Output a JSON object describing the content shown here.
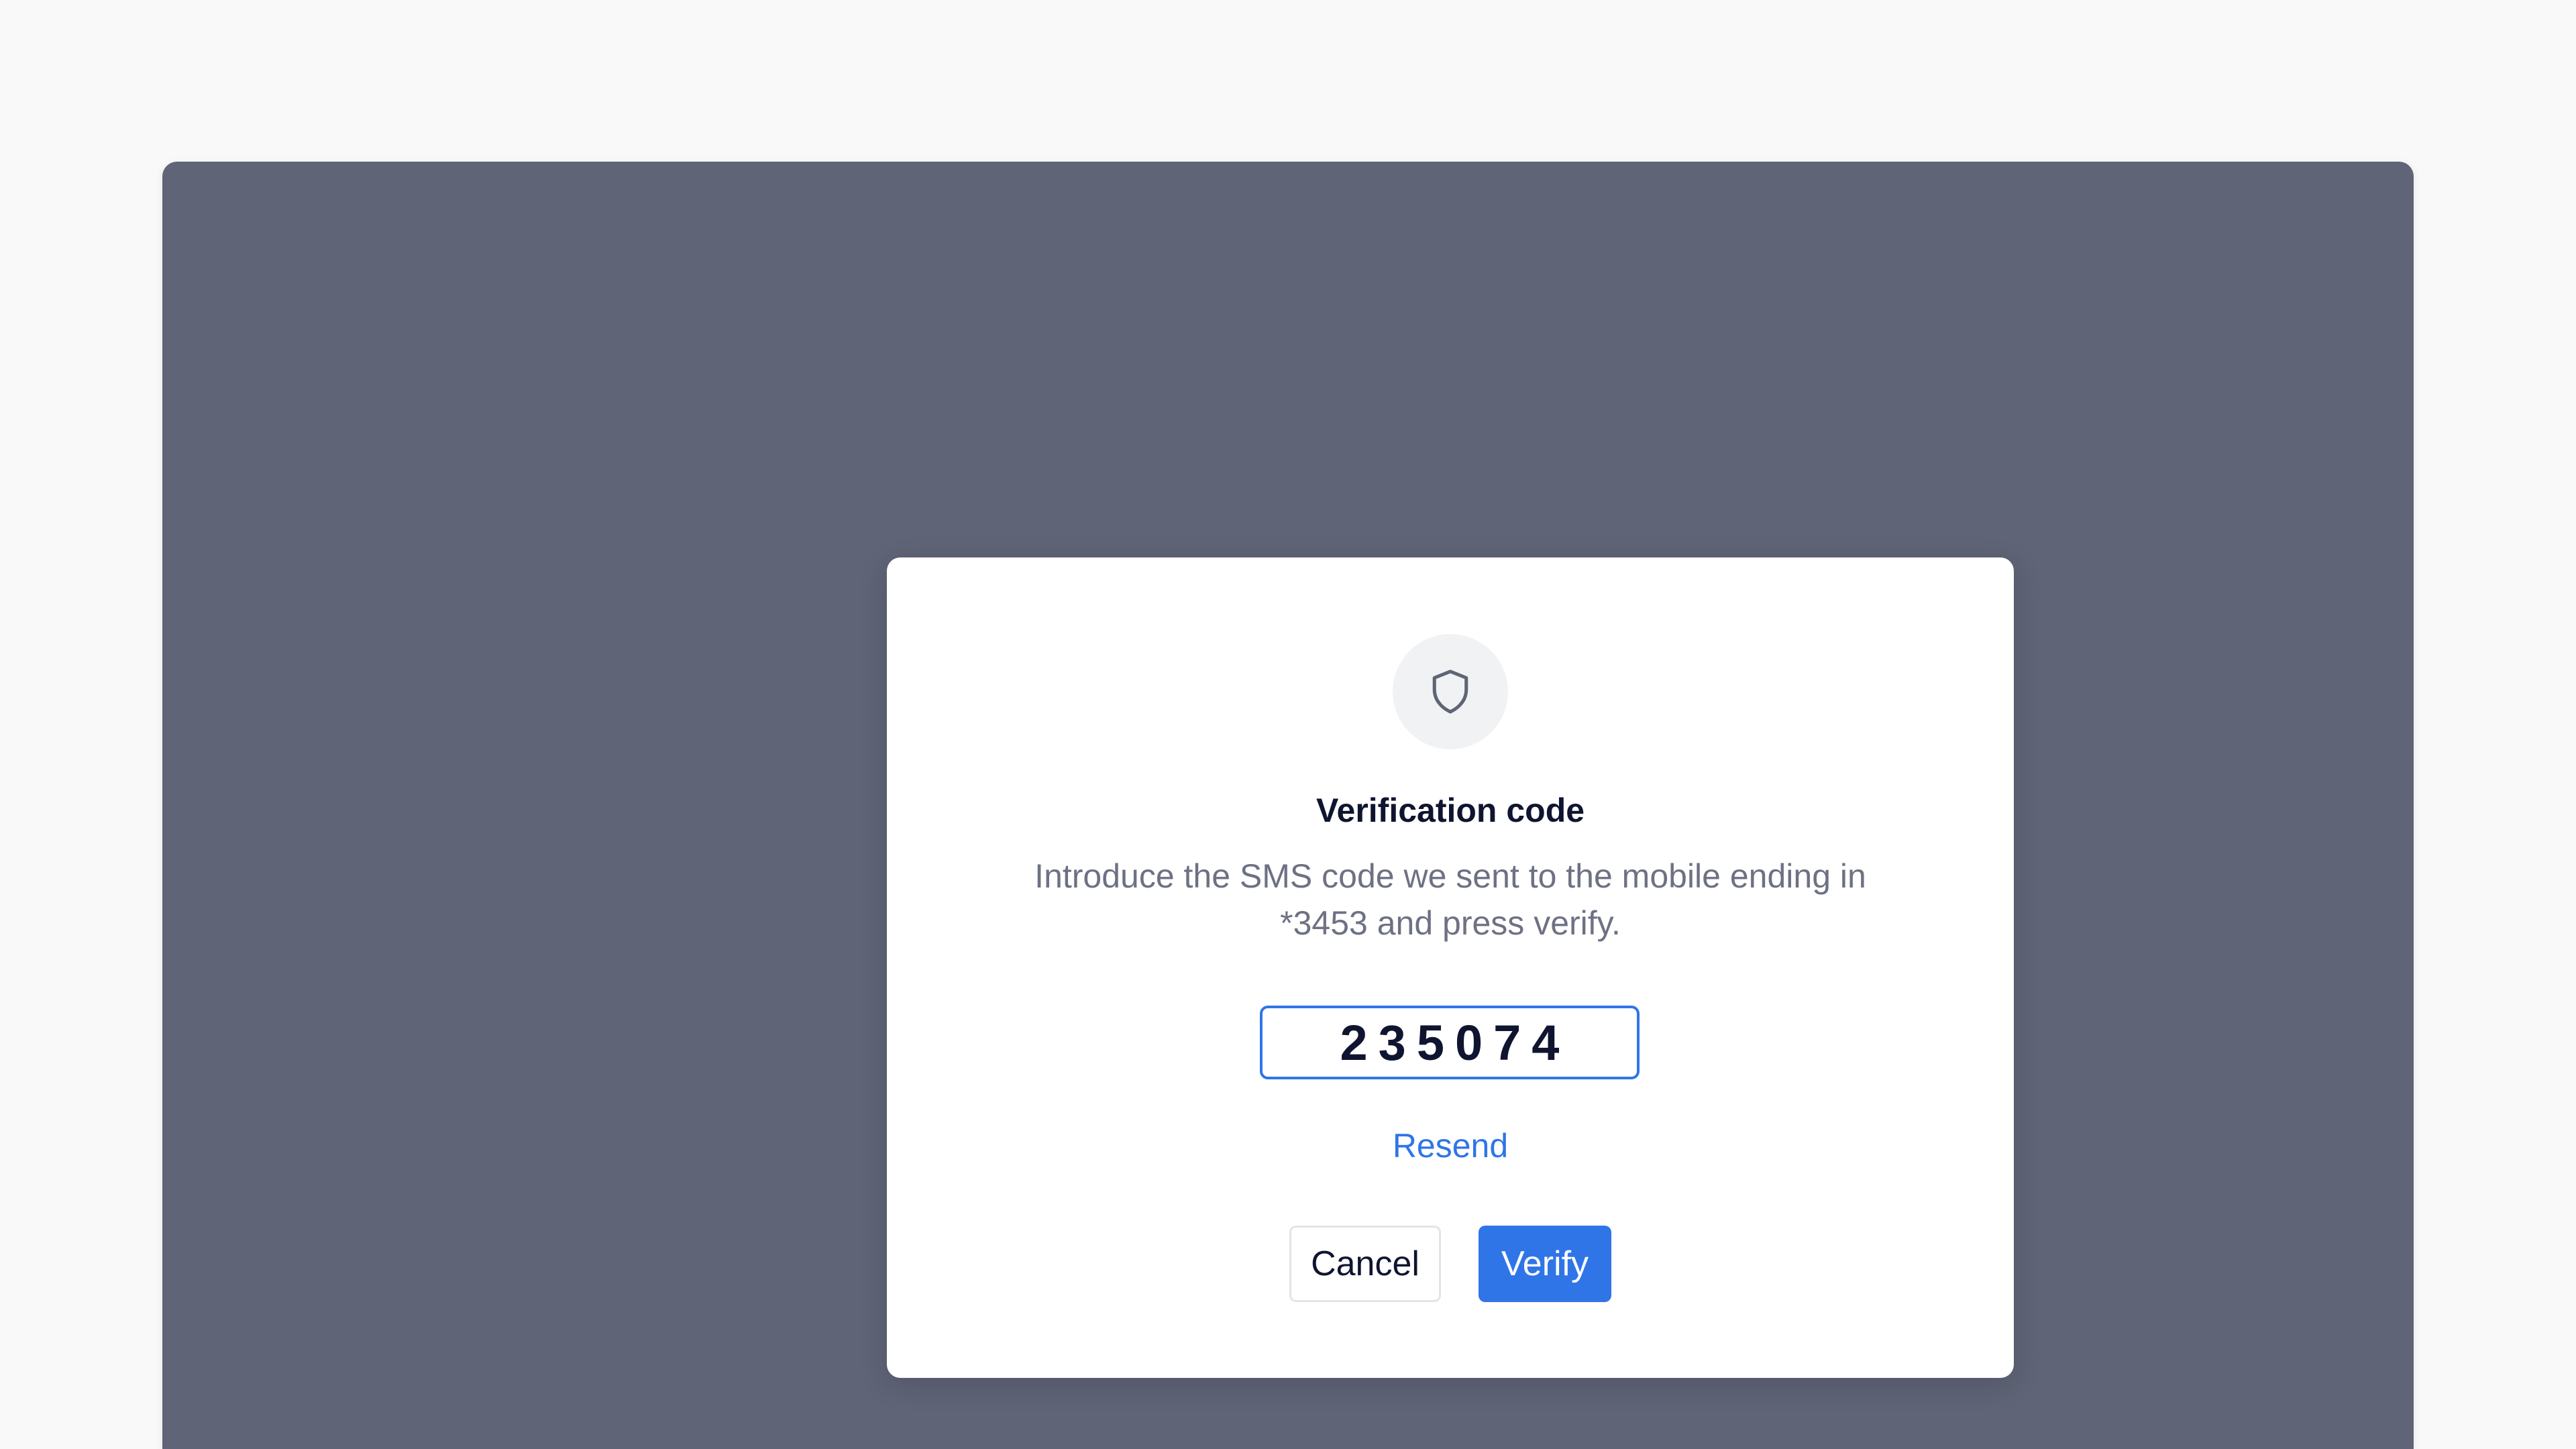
{
  "dialog": {
    "icon": "shield-icon",
    "title": "Verification code",
    "description": "Introduce the SMS code we sent to the mobile ending in *3453 and press verify.",
    "code_value": "235074",
    "resend_label": "Resend",
    "cancel_label": "Cancel",
    "verify_label": "Verify"
  },
  "colors": {
    "page_background": "#f9f9fa",
    "overlay": "#5f6476",
    "accent": "#2f75e8",
    "title_text": "#0f1530",
    "body_text": "#6d7183"
  }
}
